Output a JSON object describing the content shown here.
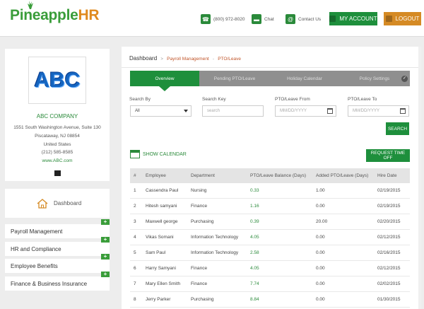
{
  "header": {
    "logo_part1": "Pineapple",
    "logo_part2": "HR",
    "phone": "(800) 972-8020",
    "chat": "Chat",
    "contact": "Contact Us",
    "account_label": "MY ACCOUNT",
    "logout_label": "LOGOUT"
  },
  "company": {
    "logo_text": "ABC",
    "name": "ABC COMPANY",
    "address1": "1551 South Washington Avenue, Suite 130",
    "address2": "Piscataway, NJ 08854",
    "country": "United States",
    "phone": "(212) 585-8585",
    "website": "www.ABC.com"
  },
  "sidebar": {
    "dashboard": "Dashboard",
    "items": [
      {
        "label": "Payroll Management"
      },
      {
        "label": "HR and Compliance"
      },
      {
        "label": "Employee Benefits"
      },
      {
        "label": "Finance & Business Insurance"
      }
    ],
    "plus": "+"
  },
  "breadcrumb": {
    "root": "Dashboard",
    "sep1": ">",
    "crumb1": "Payroll Management",
    "sep2": "-",
    "crumb2": "PTO/Leave"
  },
  "tabs": [
    {
      "label": "Overview"
    },
    {
      "label": "Pending PTO/Leave"
    },
    {
      "label": "Holiday Calendar"
    },
    {
      "label": "Policy Settings"
    }
  ],
  "filters": {
    "search_by_label": "Search By",
    "search_by_value": "All",
    "search_key_label": "Search Key",
    "search_key_placeholder": "search",
    "from_label": "PTO/Leave From",
    "from_placeholder": "MM/DD/YYYY",
    "to_label": "PTO/Leave To",
    "to_placeholder": "MM/DD/YYYY",
    "search_button": "SEARCH"
  },
  "actions": {
    "show_calendar": "SHOW CALENDAR",
    "request_time_off": "REQUEST TIME OFF"
  },
  "table": {
    "headers": [
      "#",
      "Employee",
      "Department",
      "PTO/Leave Balance (Days)",
      "Added PTO/Leave (Days)",
      "Hire Date"
    ],
    "rows": [
      [
        "1",
        "Cassendra Paul",
        "Nursing",
        "0.33",
        "1.00",
        "02/19/2015"
      ],
      [
        "2",
        "Hitesh samyani",
        "Finance",
        "1.16",
        "0.00",
        "02/19/2015"
      ],
      [
        "3",
        "Maxwell george",
        "Purchasing",
        "0.39",
        "20.00",
        "02/20/2015"
      ],
      [
        "4",
        "Vikas Somani",
        "Information Technology",
        "4.05",
        "0.00",
        "02/12/2015"
      ],
      [
        "5",
        "Sam Paul",
        "Information Technology",
        "2.58",
        "0.00",
        "02/16/2015"
      ],
      [
        "6",
        "Harry Samyani",
        "Finance",
        "4.05",
        "0.00",
        "02/12/2015"
      ],
      [
        "7",
        "Mary Ellen Smith",
        "Finance",
        "7.74",
        "0.00",
        "02/02/2015"
      ],
      [
        "8",
        "Jerry Parker",
        "Purchasing",
        "8.84",
        "0.00",
        "01/30/2015"
      ]
    ]
  },
  "colors": {
    "brand_green": "#1e8f3c",
    "brand_orange": "#d58a24",
    "tab_gray": "#8f8f8f"
  }
}
